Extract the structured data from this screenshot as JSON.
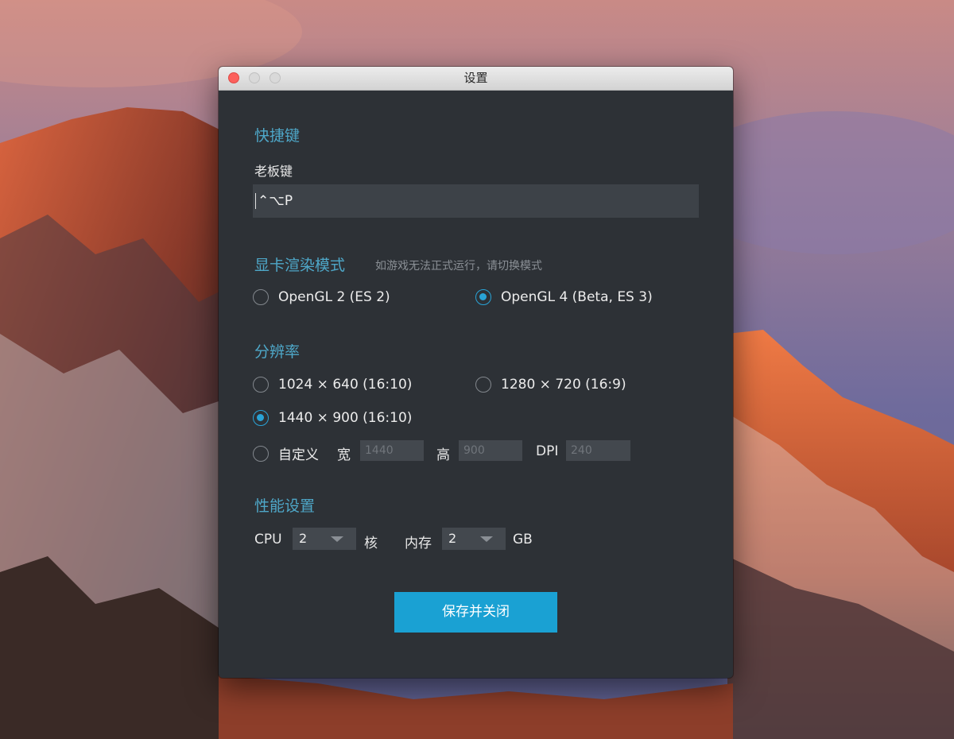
{
  "window": {
    "title": "设置"
  },
  "hotkey": {
    "section_title": "快捷键",
    "boss_key_label": "老板键",
    "boss_key_value": "⌃⌥P"
  },
  "render_mode": {
    "section_title": "显卡渲染模式",
    "hint": "如游戏无法正式运行，请切换模式",
    "options": [
      {
        "label": "OpenGL 2 (ES 2)",
        "selected": false
      },
      {
        "label": "OpenGL 4 (Beta, ES 3)",
        "selected": true
      }
    ]
  },
  "resolution": {
    "section_title": "分辨率",
    "options": [
      {
        "label": "1024 × 640 (16:10)",
        "selected": false
      },
      {
        "label": "1280 × 720 (16:9)",
        "selected": false
      },
      {
        "label": "1440 × 900 (16:10)",
        "selected": true
      },
      {
        "label": "自定义",
        "selected": false
      }
    ],
    "custom": {
      "width_label": "宽",
      "width_placeholder": "1440",
      "height_label": "高",
      "height_placeholder": "900",
      "dpi_label": "DPI",
      "dpi_placeholder": "240"
    }
  },
  "performance": {
    "section_title": "性能设置",
    "cpu_label": "CPU",
    "cpu_value": "2",
    "cpu_unit": "核",
    "memory_label": "内存",
    "memory_value": "2",
    "memory_unit": "GB"
  },
  "actions": {
    "save_label": "保存并关闭"
  },
  "colors": {
    "accent": "#1aa1d3",
    "section_title": "#4ea7c8",
    "window_bg": "#2d3136"
  }
}
